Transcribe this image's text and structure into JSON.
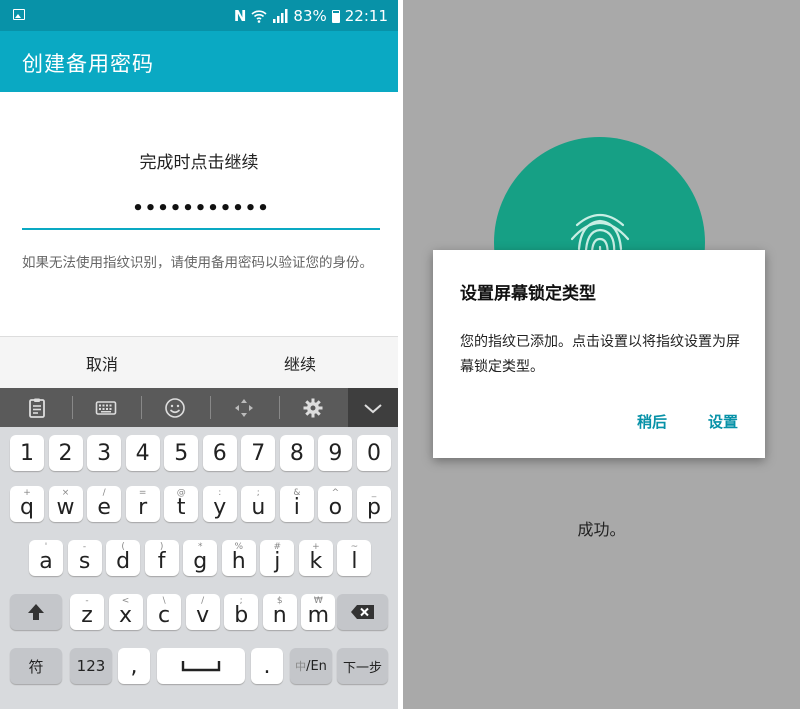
{
  "left_screen": {
    "status_bar": {
      "nfc": "N",
      "battery": "83%",
      "time": "22:11",
      "icons": [
        "image-notification-icon",
        "nfc-icon",
        "wifi-icon",
        "signal-icon",
        "battery-icon"
      ]
    },
    "action_bar": {
      "title": "创建备用密码"
    },
    "prompt": "完成时点击继续",
    "password_field": {
      "value": "•••••••••••"
    },
    "hint": "如果无法使用指纹识别，请使用备用密码以验证您的身份。",
    "buttons": {
      "cancel": "取消",
      "continue": "继续"
    },
    "keyboard": {
      "toolbar_icons": [
        "clipboard-icon",
        "keyboard-icon",
        "emoji-icon",
        "move-icon",
        "settings-icon",
        "collapse-icon"
      ],
      "number_row": [
        "1",
        "2",
        "3",
        "4",
        "5",
        "6",
        "7",
        "8",
        "9",
        "0"
      ],
      "row1": [
        {
          "k": "q",
          "h": "+"
        },
        {
          "k": "w",
          "h": "×"
        },
        {
          "k": "e",
          "h": "/"
        },
        {
          "k": "r",
          "h": "="
        },
        {
          "k": "t",
          "h": "@"
        },
        {
          "k": "y",
          "h": ":"
        },
        {
          "k": "u",
          "h": ";"
        },
        {
          "k": "i",
          "h": "&"
        },
        {
          "k": "o",
          "h": "^"
        },
        {
          "k": "p",
          "h": "_"
        }
      ],
      "row2": [
        {
          "k": "a",
          "h": "'"
        },
        {
          "k": "s",
          "h": "-"
        },
        {
          "k": "d",
          "h": "("
        },
        {
          "k": "f",
          "h": ")"
        },
        {
          "k": "g",
          "h": "*"
        },
        {
          "k": "h",
          "h": "%"
        },
        {
          "k": "j",
          "h": "#"
        },
        {
          "k": "k",
          "h": "+"
        },
        {
          "k": "l",
          "h": "~"
        }
      ],
      "row3": [
        {
          "k": "z",
          "h": "-"
        },
        {
          "k": "x",
          "h": "<"
        },
        {
          "k": "c",
          "h": "\\"
        },
        {
          "k": "v",
          "h": "/"
        },
        {
          "k": "b",
          "h": ";"
        },
        {
          "k": "n",
          "h": "$"
        },
        {
          "k": "m",
          "h": "₩"
        }
      ],
      "symbols_key": "符",
      "numbers_key": "123",
      "comma_key": ",",
      "period_key": ".",
      "lang_key_prefix": "中",
      "lang_key_suffix": "/En",
      "next_key": "下一步"
    }
  },
  "right_screen": {
    "dialog": {
      "title": "设置屏幕锁定类型",
      "message": "您的指纹已添加。点击设置以将指纹设置为屏幕锁定类型。",
      "later": "稍后",
      "setup": "设置"
    },
    "success": "成功。"
  },
  "colors": {
    "status_bar": "#0892a8",
    "action_bar": "#0aa9c3",
    "accent": "#0aa9c3",
    "fingerprint_circle": "#16a085",
    "dialog_button": "#0892a8",
    "dim_background": "#a9a9a9"
  }
}
